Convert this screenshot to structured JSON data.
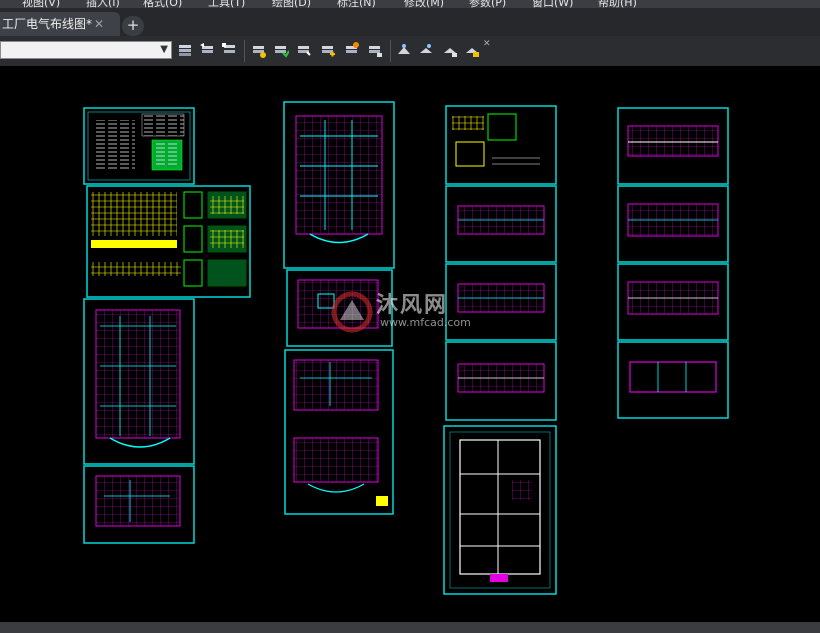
{
  "menubar": {
    "items": [
      "视图(V)",
      "插入(I)",
      "格式(O)",
      "工具(T)",
      "绘图(D)",
      "标注(N)",
      "修改(M)",
      "参数(P)",
      "窗口(W)",
      "帮助(H)"
    ]
  },
  "tabs": [
    {
      "label": "工厂电气布线图*",
      "active": true
    }
  ],
  "toolbar": {
    "layer_select_value": "",
    "icons": [
      "layer-properties-icon",
      "layer-previous-icon",
      "layer-state-icon",
      "match-layer-icon",
      "layer-isolate-icon",
      "layer-unisolate-icon",
      "layer-freeze-icon",
      "layer-off-icon",
      "layer-lock-icon",
      "layer-walk-icon",
      "layer-merge-icon",
      "layer-delete-icon",
      "layer-copy-icon",
      "layer-unlock-icon"
    ]
  },
  "watermark": {
    "text": "沐风网",
    "url": "www.mfcad.com"
  },
  "colors": {
    "canvas": "#000000",
    "sheet_border": "#00d8d8",
    "walls": "#e000e0",
    "text": "#ffffff",
    "highlight": "#ffff00",
    "wiring": "#00ffff",
    "tables": "#00ff00"
  },
  "drawing_sheets": [
    "sheet-cover-notes",
    "sheet-distribution-diagram",
    "sheet-floor-plan-1",
    "sheet-floor-plan-2",
    "sheet-tall-plan-1",
    "sheet-small-plan",
    "sheet-tall-plan-2",
    "sheet-detail",
    "sheet-wide-plan-1",
    "sheet-wide-plan-2",
    "sheet-wide-plan-3",
    "sheet-large-layout",
    "sheet-wide-plan-4",
    "sheet-wide-plan-5",
    "sheet-wide-plan-6",
    "sheet-wide-plan-7"
  ]
}
